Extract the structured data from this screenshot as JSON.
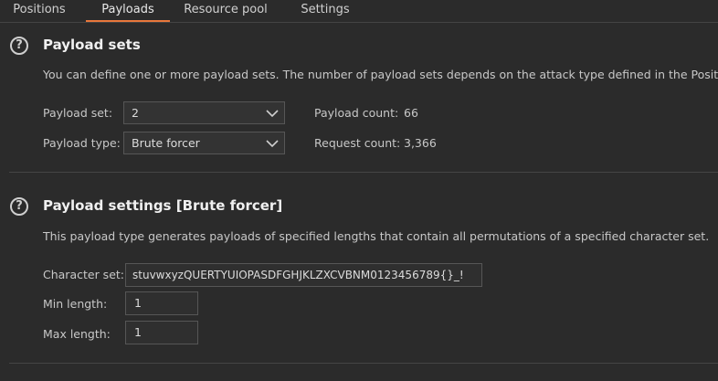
{
  "tabs": [
    {
      "label": "Positions"
    },
    {
      "label": "Payloads"
    },
    {
      "label": "Resource pool"
    },
    {
      "label": "Settings"
    }
  ],
  "payload_sets": {
    "title": "Payload sets",
    "description": "You can define one or more payload sets. The number of payload sets depends on the attack type defined in the Positions",
    "set_label": "Payload set:",
    "set_value": "2",
    "type_label": "Payload type:",
    "type_value": "Brute forcer",
    "count_label": "Payload count:",
    "count_value": "66",
    "request_label": "Request count:",
    "request_value": "3,366"
  },
  "payload_settings": {
    "title": "Payload settings [Brute forcer]",
    "description": "This payload type generates payloads of specified lengths that contain all permutations of a specified character set.",
    "charset_label": "Character set:",
    "charset_value": "stuvwxyzQUERTYUIOPASDFGHJKLZXCVBNM0123456789{}_!",
    "min_label": "Min length:",
    "min_value": "1",
    "max_label": "Max length:",
    "max_value": "1"
  },
  "icons": {
    "help": "help-icon",
    "dropdown": "chevron-down-icon"
  },
  "colors": {
    "background": "#2b2b2b",
    "accent": "#e8773b",
    "text": "#d4d4d4"
  }
}
